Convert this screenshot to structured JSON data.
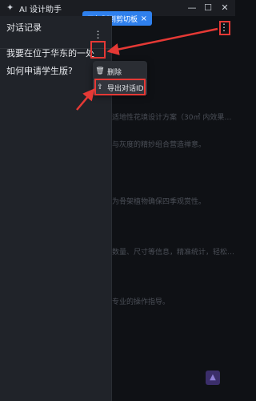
{
  "window": {
    "title": "AI 设计助手"
  },
  "toast": {
    "text": "已复制到剪切板",
    "close": "×"
  },
  "sidebar": {
    "header": "对话记录",
    "items": [
      {
        "label": "我要在位于华东的一处"
      },
      {
        "label": "如何申请学生版?"
      }
    ]
  },
  "context_menu": {
    "items": [
      {
        "label": "删除",
        "icon": "trash-icon"
      },
      {
        "label": "导出对话ID",
        "icon": "export-icon"
      }
    ]
  },
  "background_text": [
    "适地性花境设计方案（30㎡ 内效果…",
    "与灰度的精妙组合营造禅意。",
    "为骨架植物确保四季观赏性。",
    "数量、尺寸等信息，精准统计，轻松…",
    "专业的操作指导。"
  ],
  "colors": {
    "accent": "#2f80ed",
    "highlight": "#e53935"
  }
}
